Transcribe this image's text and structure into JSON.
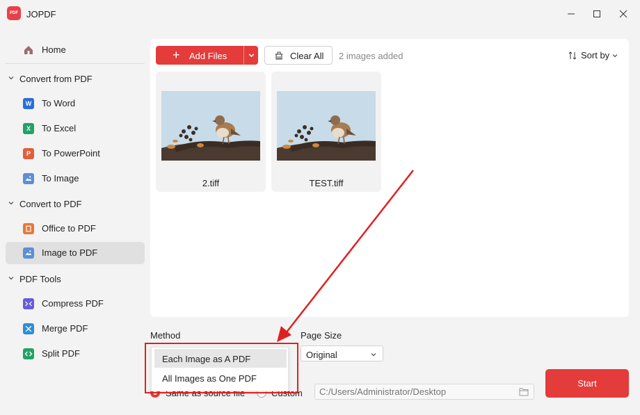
{
  "window": {
    "app_logo_text": "PDF",
    "title": "JOPDF",
    "minimize_icon": "minimize-icon",
    "maximize_icon": "maximize-icon",
    "close_icon": "close-icon"
  },
  "sidebar": {
    "home": "Home",
    "groups": [
      {
        "label": "Convert from PDF",
        "items": [
          "To Word",
          "To Excel",
          "To PowerPoint",
          "To Image"
        ]
      },
      {
        "label": "Convert to PDF",
        "items": [
          "Office to PDF",
          "Image to PDF"
        ]
      },
      {
        "label": "PDF Tools",
        "items": [
          "Compress PDF",
          "Merge PDF",
          "Split PDF"
        ]
      }
    ],
    "active_item": "Image to PDF",
    "icon_glyphs": {
      "word": "W",
      "excel": "X",
      "powerpoint": "P"
    },
    "colors": {
      "word": "#2b6fd6",
      "excel": "#21a366",
      "powerpoint": "#e0603b",
      "image": "#5b8fd6",
      "office": "#e8773a",
      "compress": "#6a5bd6",
      "merge": "#2c8fd6",
      "split": "#21a366"
    }
  },
  "toolbar": {
    "add_files": "Add Files",
    "clear_all": "Clear All",
    "images_count": "2 images added",
    "sort_by": "Sort by"
  },
  "files": [
    {
      "name": "2.tiff"
    },
    {
      "name": "TEST.tiff"
    }
  ],
  "options": {
    "method_label": "Method",
    "method_options": [
      "Each Image as A PDF",
      "All Images as One PDF"
    ],
    "method_highlighted": "Each Image as A PDF",
    "page_size_label": "Page Size",
    "page_size_value": "Original",
    "output_same": "Same as source file",
    "output_custom": "Custom",
    "output_path": "C:/Users/Administrator/Desktop",
    "start": "Start"
  },
  "accent_color": "#e43b3b"
}
